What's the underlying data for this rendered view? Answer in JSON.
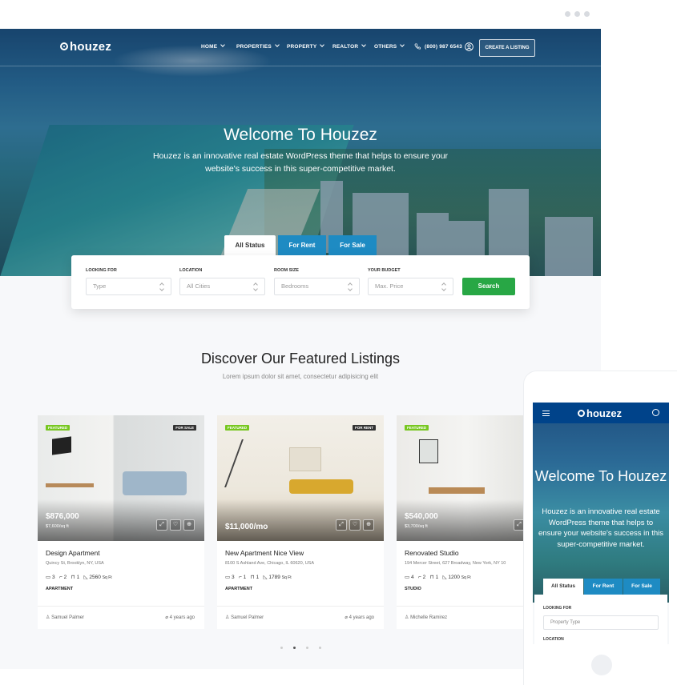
{
  "nav": {
    "logo": "houzez",
    "items": [
      "HOME",
      "PROPERTIES",
      "PROPERTY",
      "REALTOR",
      "OTHERS"
    ],
    "phone": "(800) 987 6543",
    "cta": "CREATE A LISTING"
  },
  "hero": {
    "title": "Welcome To Houzez",
    "subtitle": "Houzez is an innovative real estate WordPress theme that helps to ensure your website's success in this super-competitive market."
  },
  "tabs": [
    "All Status",
    "For Rent",
    "For Sale"
  ],
  "search": {
    "fields": [
      {
        "label": "LOOKING FOR",
        "placeholder": "Type"
      },
      {
        "label": "LOCATION",
        "placeholder": "All Cities"
      },
      {
        "label": "ROOM SIZE",
        "placeholder": "Bedrooms"
      },
      {
        "label": "YOUR BUDGET",
        "placeholder": "Max. Price"
      }
    ],
    "button": "Search"
  },
  "featured": {
    "title": "Discover Our Featured Listings",
    "subtitle": "Lorem ipsum dolor sit amet, consectetur adipisicing elit"
  },
  "listings": [
    {
      "featured": "FEATURED",
      "status": "FOR SALE",
      "price": "$876,000",
      "price_per_sqft": "$7,600/sq ft",
      "title": "Design Apartment",
      "address": "Quincy St, Brooklyn, NY, USA",
      "beds": "3",
      "baths": "2",
      "garage": "1",
      "size": "2560",
      "size_unit": "Sq Ft",
      "type": "APARTMENT",
      "agent": "Samuel Palmer",
      "date": "4 years ago"
    },
    {
      "featured": "FEATURED",
      "status": "FOR RENT",
      "price": "$11,000/mo",
      "price_per_sqft": "",
      "title": "New Apartment Nice View",
      "address": "8100 S Ashland Ave, Chicago, IL 60620, USA",
      "beds": "3",
      "baths": "1",
      "garage": "1",
      "size": "1789",
      "size_unit": "Sq Ft",
      "type": "APARTMENT",
      "agent": "Samuel Palmer",
      "date": "4 years ago"
    },
    {
      "featured": "FEATURED",
      "status": "",
      "price": "$540,000",
      "price_per_sqft": "$3,700/sq ft",
      "title": "Renovated Studio",
      "address": "194 Mercer Street, 627 Broadway, New York, NY 10",
      "beds": "4",
      "baths": "2",
      "garage": "1",
      "size": "1200",
      "size_unit": "Sq Ft",
      "type": "STUDIO",
      "agent": "Michelle Ramirez",
      "date": ""
    }
  ],
  "mobile": {
    "logo": "houzez",
    "title": "Welcome To Houzez",
    "subtitle": "Houzez is an innovative real estate WordPress theme that helps to ensure your website's success in this super-competitive market.",
    "tabs": [
      "All Status",
      "For Rent",
      "For Sale"
    ],
    "label1": "LOOKING FOR",
    "placeholder": "Property Type",
    "label2": "LOCATION"
  },
  "colors": {
    "brand_blue": "#00438a",
    "tab_blue": "#1e8bc3",
    "search_green": "#28a745",
    "featured_badge": "#77c720"
  }
}
